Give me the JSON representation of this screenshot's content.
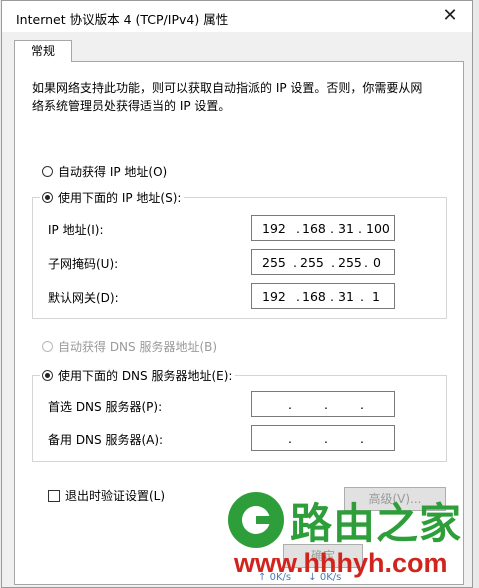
{
  "window": {
    "title": "Internet 协议版本 4 (TCP/IPv4) 属性"
  },
  "background": {
    "left_marks": [
      "络",
      "",
      "",
      "",
      "",
      "",
      "",
      "",
      "",
      ""
    ]
  },
  "tab": {
    "label": "常规"
  },
  "description": "如果网络支持此功能，则可以获取自动指派的 IP 设置。否则，你需要从网络系统管理员处获得适当的 IP 设置。",
  "ip": {
    "auto_label": "自动获得 IP 地址(O)",
    "manual_label": "使用下面的 IP 地址(S):",
    "selected": "manual",
    "fields": [
      {
        "label": "IP 地址(I):",
        "value": [
          "192",
          "168",
          "31",
          "100"
        ]
      },
      {
        "label": "子网掩码(U):",
        "value": [
          "255",
          "255",
          "255",
          "0"
        ]
      },
      {
        "label": "默认网关(D):",
        "value": [
          "192",
          "168",
          "31",
          "1"
        ]
      }
    ]
  },
  "dns": {
    "auto_label": "自动获得 DNS 服务器地址(B)",
    "manual_label": "使用下面的 DNS 服务器地址(E):",
    "selected": "manual",
    "fields": [
      {
        "label": "首选 DNS 服务器(P):",
        "value": [
          "",
          "",
          "",
          ""
        ]
      },
      {
        "label": "备用 DNS 服务器(A):",
        "value": [
          "",
          "",
          "",
          ""
        ]
      }
    ]
  },
  "exit_validate_label": "退出时验证设置(L)",
  "advanced_label": "高级(V)...",
  "ok_label": "确定",
  "watermark": {
    "title": "路由之家",
    "url": "www.hhhyh.com"
  },
  "tray": {
    "up": "0K/s",
    "down": "0K/s"
  },
  "colors": {
    "watermark_green": "#2e9e3a",
    "watermark_red": "#d0241c"
  }
}
